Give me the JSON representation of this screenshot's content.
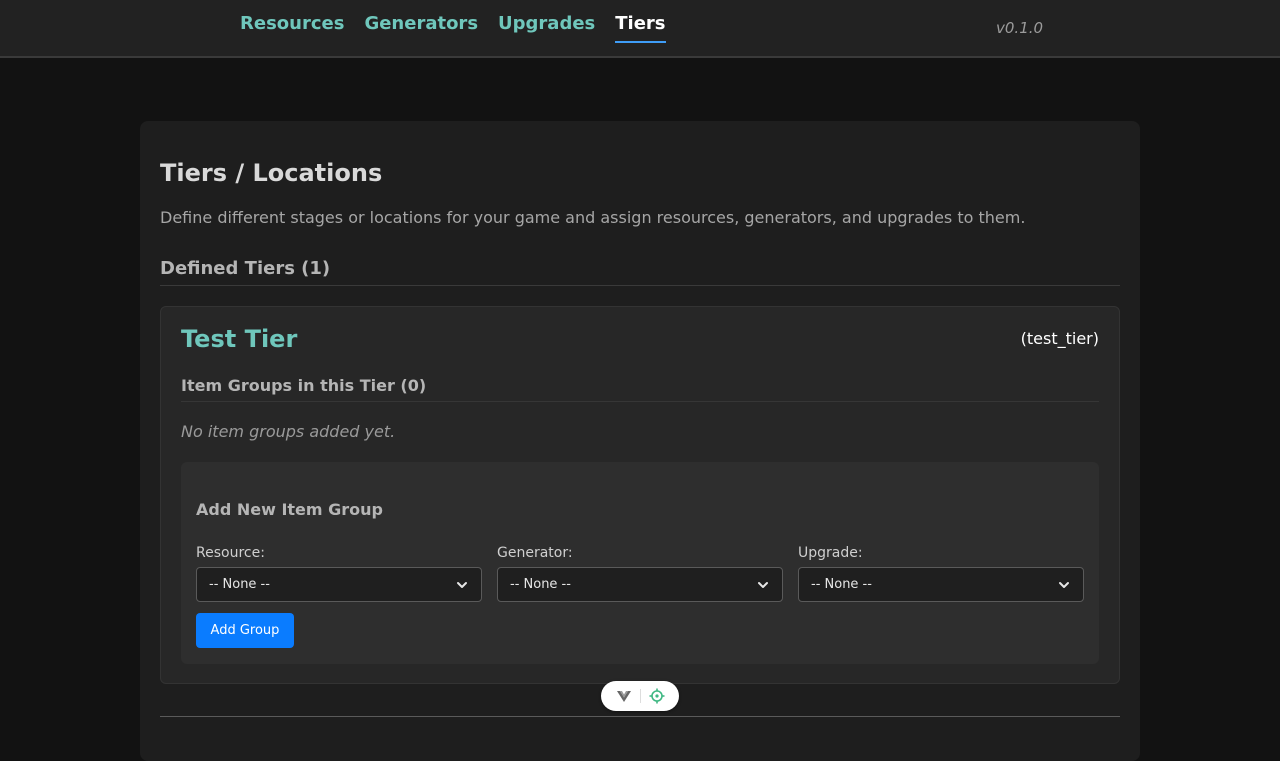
{
  "nav": {
    "links": [
      {
        "label": "Resources"
      },
      {
        "label": "Generators"
      },
      {
        "label": "Upgrades"
      },
      {
        "label": "Tiers"
      }
    ],
    "active": "Tiers",
    "version": "v0.1.0"
  },
  "page": {
    "title": "Tiers / Locations",
    "description": "Define different stages or locations for your game and assign resources, generators, and upgrades to them.",
    "defined_tiers_title": "Defined Tiers (1)"
  },
  "tier": {
    "name": "Test Tier",
    "id_label": "(test_tier)",
    "groups_title": "Item Groups in this Tier (0)",
    "empty_message": "No item groups added yet."
  },
  "add_group": {
    "title": "Add New Item Group",
    "resource_label": "Resource:",
    "resource_value": "-- None --",
    "generator_label": "Generator:",
    "generator_value": "-- None --",
    "upgrade_label": "Upgrade:",
    "upgrade_value": "-- None --",
    "button_label": "Add Group"
  },
  "icons": {
    "select_arrow": "chevron-down-icon",
    "devtools_logo": "vue-logo-icon",
    "devtools_inspect": "target-icon"
  },
  "colors": {
    "accent": "#6fc7bc",
    "primary_button": "#0a7cff",
    "active_underline": "#3f9df7"
  }
}
